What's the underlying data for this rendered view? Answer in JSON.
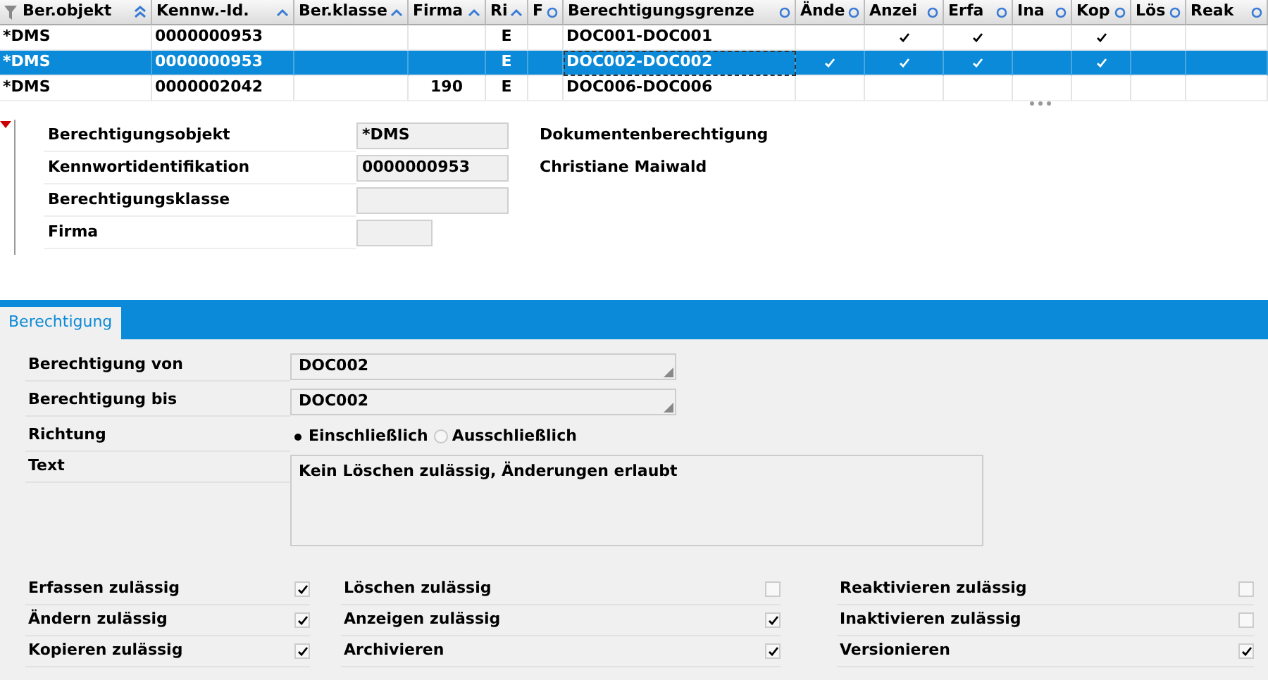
{
  "table": {
    "columns": [
      {
        "label": "Ber.objekt",
        "kind": "text",
        "sorted": true,
        "primary": true,
        "filtered": true
      },
      {
        "label": "Kennw.-Id.",
        "kind": "text",
        "sorted": true,
        "primary": false,
        "filtered": false
      },
      {
        "label": "Ber.klasse",
        "kind": "text",
        "sorted": true,
        "primary": false,
        "filtered": false
      },
      {
        "label": "Firma",
        "kind": "text",
        "sorted": true,
        "primary": false,
        "filtered": false
      },
      {
        "label": "Ri",
        "kind": "text",
        "sorted": true,
        "primary": false,
        "filtered": false
      },
      {
        "label": "F",
        "kind": "text",
        "sorted": false,
        "primary": false,
        "filtered": false
      },
      {
        "label": "Berechtigungsgrenze",
        "kind": "text",
        "sorted": false,
        "primary": false,
        "filtered": false
      },
      {
        "label": "Ände",
        "kind": "check",
        "sorted": false,
        "primary": false,
        "filtered": false
      },
      {
        "label": "Anzei",
        "kind": "check",
        "sorted": false,
        "primary": false,
        "filtered": false
      },
      {
        "label": "Erfa",
        "kind": "check",
        "sorted": false,
        "primary": false,
        "filtered": false
      },
      {
        "label": "Ina",
        "kind": "check",
        "sorted": false,
        "primary": false,
        "filtered": false
      },
      {
        "label": "Kop",
        "kind": "check",
        "sorted": false,
        "primary": false,
        "filtered": false
      },
      {
        "label": "Lös",
        "kind": "check",
        "sorted": false,
        "primary": false,
        "filtered": false
      },
      {
        "label": "Reak",
        "kind": "check",
        "sorted": false,
        "primary": false,
        "filtered": false
      }
    ],
    "rows": [
      {
        "selected": false,
        "focused": false,
        "cells": [
          "*DMS",
          "0000000953",
          null,
          null,
          "E",
          null,
          "DOC001-DOC001"
        ],
        "checks": [
          false,
          true,
          true,
          false,
          true,
          false,
          false
        ]
      },
      {
        "selected": true,
        "focused": true,
        "cells": [
          "*DMS",
          "0000000953",
          null,
          null,
          "E",
          null,
          "DOC002-DOC002"
        ],
        "checks": [
          true,
          true,
          true,
          false,
          true,
          false,
          false
        ]
      },
      {
        "selected": false,
        "focused": false,
        "cells": [
          "*DMS",
          "0000002042",
          null,
          "190",
          "E",
          null,
          "DOC006-DOC006"
        ],
        "checks": [
          false,
          false,
          false,
          false,
          false,
          false,
          false
        ]
      }
    ]
  },
  "details": {
    "expanded": true,
    "fields": [
      {
        "label": "Berechtigungsobjekt",
        "value": "*DMS",
        "description": "Dokumentenberechtigung",
        "kind": "wide"
      },
      {
        "label": "Kennwortidentifikation",
        "value": "0000000953",
        "description": "Christiane Maiwald",
        "kind": "wide"
      },
      {
        "label": "Berechtigungsklasse",
        "kind": "wide"
      },
      {
        "label": "Firma",
        "kind": "narrow"
      }
    ]
  },
  "tabs": [
    {
      "label": "Berechtigung",
      "selected": true
    }
  ],
  "form": {
    "von": {
      "label": "Berechtigung von",
      "value": "DOC002"
    },
    "bis": {
      "label": "Berechtigung bis",
      "value": "DOC002"
    },
    "richtung": {
      "label": "Richtung",
      "options": [
        {
          "label": "Einschließlich",
          "selected": true
        },
        {
          "label": "Ausschließlich",
          "selected": false
        }
      ]
    },
    "text": {
      "label": "Text",
      "value": "Kein Löschen zulässig, Änderungen erlaubt"
    }
  },
  "permissions": [
    [
      {
        "label": "Erfassen zulässig",
        "checked": true
      },
      {
        "label": "Ändern zulässig",
        "checked": true
      },
      {
        "label": "Kopieren zulässig",
        "checked": true
      }
    ],
    [
      {
        "label": "Löschen zulässig",
        "checked": false
      },
      {
        "label": "Anzeigen zulässig",
        "checked": true
      },
      {
        "label": "Archivieren",
        "checked": true
      }
    ],
    [
      {
        "label": "Reaktivieren zulässig",
        "checked": false
      },
      {
        "label": "Inaktivieren zulässig",
        "checked": false
      },
      {
        "label": "Versionieren",
        "checked": true
      }
    ]
  ]
}
